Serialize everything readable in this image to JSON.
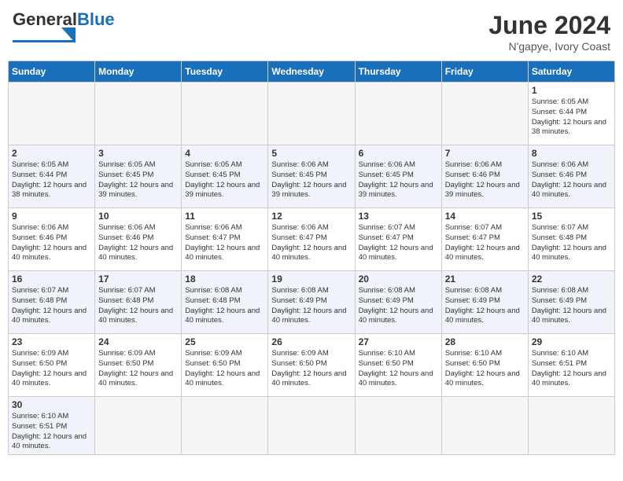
{
  "header": {
    "logo_general": "General",
    "logo_blue": "Blue",
    "title": "June 2024",
    "subtitle": "N'gapye, Ivory Coast"
  },
  "weekdays": [
    "Sunday",
    "Monday",
    "Tuesday",
    "Wednesday",
    "Thursday",
    "Friday",
    "Saturday"
  ],
  "weeks": [
    [
      {
        "day": "",
        "info": ""
      },
      {
        "day": "",
        "info": ""
      },
      {
        "day": "",
        "info": ""
      },
      {
        "day": "",
        "info": ""
      },
      {
        "day": "",
        "info": ""
      },
      {
        "day": "",
        "info": ""
      },
      {
        "day": "1",
        "info": "Sunrise: 6:05 AM\nSunset: 6:44 PM\nDaylight: 12 hours\nand 38 minutes."
      }
    ],
    [
      {
        "day": "2",
        "info": "Sunrise: 6:05 AM\nSunset: 6:44 PM\nDaylight: 12 hours\nand 38 minutes."
      },
      {
        "day": "3",
        "info": "Sunrise: 6:05 AM\nSunset: 6:45 PM\nDaylight: 12 hours\nand 39 minutes."
      },
      {
        "day": "4",
        "info": "Sunrise: 6:05 AM\nSunset: 6:45 PM\nDaylight: 12 hours\nand 39 minutes."
      },
      {
        "day": "5",
        "info": "Sunrise: 6:06 AM\nSunset: 6:45 PM\nDaylight: 12 hours\nand 39 minutes."
      },
      {
        "day": "6",
        "info": "Sunrise: 6:06 AM\nSunset: 6:45 PM\nDaylight: 12 hours\nand 39 minutes."
      },
      {
        "day": "7",
        "info": "Sunrise: 6:06 AM\nSunset: 6:46 PM\nDaylight: 12 hours\nand 39 minutes."
      },
      {
        "day": "8",
        "info": "Sunrise: 6:06 AM\nSunset: 6:46 PM\nDaylight: 12 hours\nand 40 minutes."
      }
    ],
    [
      {
        "day": "9",
        "info": "Sunrise: 6:06 AM\nSunset: 6:46 PM\nDaylight: 12 hours\nand 40 minutes."
      },
      {
        "day": "10",
        "info": "Sunrise: 6:06 AM\nSunset: 6:46 PM\nDaylight: 12 hours\nand 40 minutes."
      },
      {
        "day": "11",
        "info": "Sunrise: 6:06 AM\nSunset: 6:47 PM\nDaylight: 12 hours\nand 40 minutes."
      },
      {
        "day": "12",
        "info": "Sunrise: 6:06 AM\nSunset: 6:47 PM\nDaylight: 12 hours\nand 40 minutes."
      },
      {
        "day": "13",
        "info": "Sunrise: 6:07 AM\nSunset: 6:47 PM\nDaylight: 12 hours\nand 40 minutes."
      },
      {
        "day": "14",
        "info": "Sunrise: 6:07 AM\nSunset: 6:47 PM\nDaylight: 12 hours\nand 40 minutes."
      },
      {
        "day": "15",
        "info": "Sunrise: 6:07 AM\nSunset: 6:48 PM\nDaylight: 12 hours\nand 40 minutes."
      }
    ],
    [
      {
        "day": "16",
        "info": "Sunrise: 6:07 AM\nSunset: 6:48 PM\nDaylight: 12 hours\nand 40 minutes."
      },
      {
        "day": "17",
        "info": "Sunrise: 6:07 AM\nSunset: 6:48 PM\nDaylight: 12 hours\nand 40 minutes."
      },
      {
        "day": "18",
        "info": "Sunrise: 6:08 AM\nSunset: 6:48 PM\nDaylight: 12 hours\nand 40 minutes."
      },
      {
        "day": "19",
        "info": "Sunrise: 6:08 AM\nSunset: 6:49 PM\nDaylight: 12 hours\nand 40 minutes."
      },
      {
        "day": "20",
        "info": "Sunrise: 6:08 AM\nSunset: 6:49 PM\nDaylight: 12 hours\nand 40 minutes."
      },
      {
        "day": "21",
        "info": "Sunrise: 6:08 AM\nSunset: 6:49 PM\nDaylight: 12 hours\nand 40 minutes."
      },
      {
        "day": "22",
        "info": "Sunrise: 6:08 AM\nSunset: 6:49 PM\nDaylight: 12 hours\nand 40 minutes."
      }
    ],
    [
      {
        "day": "23",
        "info": "Sunrise: 6:09 AM\nSunset: 6:50 PM\nDaylight: 12 hours\nand 40 minutes."
      },
      {
        "day": "24",
        "info": "Sunrise: 6:09 AM\nSunset: 6:50 PM\nDaylight: 12 hours\nand 40 minutes."
      },
      {
        "day": "25",
        "info": "Sunrise: 6:09 AM\nSunset: 6:50 PM\nDaylight: 12 hours\nand 40 minutes."
      },
      {
        "day": "26",
        "info": "Sunrise: 6:09 AM\nSunset: 6:50 PM\nDaylight: 12 hours\nand 40 minutes."
      },
      {
        "day": "27",
        "info": "Sunrise: 6:10 AM\nSunset: 6:50 PM\nDaylight: 12 hours\nand 40 minutes."
      },
      {
        "day": "28",
        "info": "Sunrise: 6:10 AM\nSunset: 6:50 PM\nDaylight: 12 hours\nand 40 minutes."
      },
      {
        "day": "29",
        "info": "Sunrise: 6:10 AM\nSunset: 6:51 PM\nDaylight: 12 hours\nand 40 minutes."
      }
    ],
    [
      {
        "day": "30",
        "info": "Sunrise: 6:10 AM\nSunset: 6:51 PM\nDaylight: 12 hours\nand 40 minutes."
      },
      {
        "day": "",
        "info": ""
      },
      {
        "day": "",
        "info": ""
      },
      {
        "day": "",
        "info": ""
      },
      {
        "day": "",
        "info": ""
      },
      {
        "day": "",
        "info": ""
      },
      {
        "day": "",
        "info": ""
      }
    ]
  ]
}
